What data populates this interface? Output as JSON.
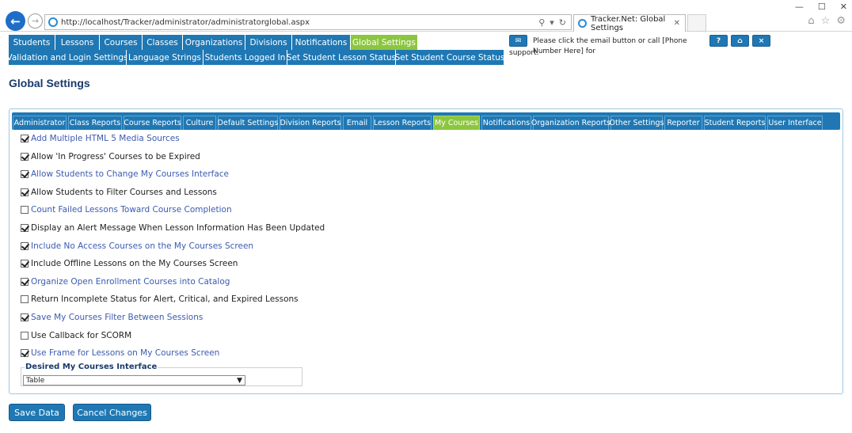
{
  "browser": {
    "url": "http://localhost/Tracker/administrator/administratorglobal.aspx",
    "tab_title": "Tracker.Net: Global Settings",
    "window_controls": [
      "—",
      "☐",
      "✕"
    ]
  },
  "nav": {
    "row1": [
      "Students",
      "Lessons",
      "Courses",
      "Classes",
      "Organizations",
      "Divisions",
      "Notifications",
      "Global Settings"
    ],
    "row2": [
      "Validation and Login Settings",
      "Language Strings",
      "Students Logged In",
      "Set Student Lesson Status",
      "Set Student Course Status"
    ],
    "active": "Global Settings"
  },
  "support": {
    "message": "Please click the email button or call [Phone Number Here] for",
    "message_tail": "support.",
    "help_label": "?",
    "home_label": "⌂",
    "close_label": "×"
  },
  "page_title": "Global Settings",
  "sub_tabs": [
    "Administrator",
    "Class Reports",
    "Course Reports",
    "Culture",
    "Default Settings",
    "Division Reports",
    "Email",
    "Lesson Reports",
    "My Courses",
    "Notifications",
    "Organization Reports",
    "Other Settings",
    "Reporter",
    "Student Reports",
    "User Interface"
  ],
  "active_sub_tab": "My Courses",
  "options": [
    {
      "label": "Add Multiple HTML 5 Media Sources",
      "checked": true,
      "link": true
    },
    {
      "label": "Allow 'In Progress' Courses to be Expired",
      "checked": true,
      "link": false
    },
    {
      "label": "Allow Students to Change My Courses Interface",
      "checked": true,
      "link": true
    },
    {
      "label": "Allow Students to Filter Courses and Lessons",
      "checked": true,
      "link": false
    },
    {
      "label": "Count Failed Lessons Toward Course Completion",
      "checked": false,
      "link": true
    },
    {
      "label": "Display an Alert Message When Lesson Information Has Been Updated",
      "checked": true,
      "link": false
    },
    {
      "label": "Include No Access Courses on the My Courses Screen",
      "checked": true,
      "link": true
    },
    {
      "label": "Include Offline Lessons on the My Courses Screen",
      "checked": true,
      "link": false
    },
    {
      "label": "Organize Open Enrollment Courses into Catalog",
      "checked": true,
      "link": true
    },
    {
      "label": "Return Incomplete Status for Alert, Critical, and Expired Lessons",
      "checked": false,
      "link": false
    },
    {
      "label": "Save My Courses Filter Between Sessions",
      "checked": true,
      "link": true
    },
    {
      "label": "Use Callback for SCORM",
      "checked": false,
      "link": false
    },
    {
      "label": "Use Frame for Lessons on My Courses Screen",
      "checked": true,
      "link": true
    }
  ],
  "interface": {
    "legend": "Desired My Courses Interface",
    "selected": "Table"
  },
  "buttons": {
    "save": "Save Data",
    "cancel": "Cancel Changes"
  },
  "colors": {
    "nav_blue": "#1f78b4",
    "active_green": "#8cc63f",
    "title_navy": "#1a3a6b",
    "link_blue": "#3b5bb0"
  }
}
